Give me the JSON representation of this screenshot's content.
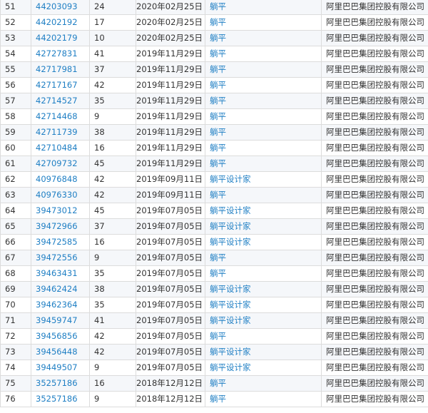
{
  "theme": {
    "link_color": "#1f7fc4",
    "text_color": "#333333",
    "border_color": "#dcdcdc",
    "stripe_color": "#f5f7fa"
  },
  "rows": [
    {
      "index": "51",
      "reg_no": "44203093",
      "class": "24",
      "date": "2020年02月25日",
      "name": "躺平",
      "owner": "阿里巴巴集团控股有限公司"
    },
    {
      "index": "52",
      "reg_no": "44202192",
      "class": "17",
      "date": "2020年02月25日",
      "name": "躺平",
      "owner": "阿里巴巴集团控股有限公司"
    },
    {
      "index": "53",
      "reg_no": "44202179",
      "class": "10",
      "date": "2020年02月25日",
      "name": "躺平",
      "owner": "阿里巴巴集团控股有限公司"
    },
    {
      "index": "54",
      "reg_no": "42727831",
      "class": "41",
      "date": "2019年11月29日",
      "name": "躺平",
      "owner": "阿里巴巴集团控股有限公司"
    },
    {
      "index": "55",
      "reg_no": "42717981",
      "class": "37",
      "date": "2019年11月29日",
      "name": "躺平",
      "owner": "阿里巴巴集团控股有限公司"
    },
    {
      "index": "56",
      "reg_no": "42717167",
      "class": "42",
      "date": "2019年11月29日",
      "name": "躺平",
      "owner": "阿里巴巴集团控股有限公司"
    },
    {
      "index": "57",
      "reg_no": "42714527",
      "class": "35",
      "date": "2019年11月29日",
      "name": "躺平",
      "owner": "阿里巴巴集团控股有限公司"
    },
    {
      "index": "58",
      "reg_no": "42714468",
      "class": "9",
      "date": "2019年11月29日",
      "name": "躺平",
      "owner": "阿里巴巴集团控股有限公司"
    },
    {
      "index": "59",
      "reg_no": "42711739",
      "class": "38",
      "date": "2019年11月29日",
      "name": "躺平",
      "owner": "阿里巴巴集团控股有限公司"
    },
    {
      "index": "60",
      "reg_no": "42710484",
      "class": "16",
      "date": "2019年11月29日",
      "name": "躺平",
      "owner": "阿里巴巴集团控股有限公司"
    },
    {
      "index": "61",
      "reg_no": "42709732",
      "class": "45",
      "date": "2019年11月29日",
      "name": "躺平",
      "owner": "阿里巴巴集团控股有限公司"
    },
    {
      "index": "62",
      "reg_no": "40976848",
      "class": "42",
      "date": "2019年09月11日",
      "name": "躺平设计家",
      "owner": "阿里巴巴集团控股有限公司"
    },
    {
      "index": "63",
      "reg_no": "40976330",
      "class": "42",
      "date": "2019年09月11日",
      "name": "躺平",
      "owner": "阿里巴巴集团控股有限公司"
    },
    {
      "index": "64",
      "reg_no": "39473012",
      "class": "45",
      "date": "2019年07月05日",
      "name": "躺平设计家",
      "owner": "阿里巴巴集团控股有限公司"
    },
    {
      "index": "65",
      "reg_no": "39472966",
      "class": "37",
      "date": "2019年07月05日",
      "name": "躺平设计家",
      "owner": "阿里巴巴集团控股有限公司"
    },
    {
      "index": "66",
      "reg_no": "39472585",
      "class": "16",
      "date": "2019年07月05日",
      "name": "躺平设计家",
      "owner": "阿里巴巴集团控股有限公司"
    },
    {
      "index": "67",
      "reg_no": "39472556",
      "class": "9",
      "date": "2019年07月05日",
      "name": "躺平",
      "owner": "阿里巴巴集团控股有限公司"
    },
    {
      "index": "68",
      "reg_no": "39463431",
      "class": "35",
      "date": "2019年07月05日",
      "name": "躺平",
      "owner": "阿里巴巴集团控股有限公司"
    },
    {
      "index": "69",
      "reg_no": "39462424",
      "class": "38",
      "date": "2019年07月05日",
      "name": "躺平设计家",
      "owner": "阿里巴巴集团控股有限公司"
    },
    {
      "index": "70",
      "reg_no": "39462364",
      "class": "35",
      "date": "2019年07月05日",
      "name": "躺平设计家",
      "owner": "阿里巴巴集团控股有限公司"
    },
    {
      "index": "71",
      "reg_no": "39459747",
      "class": "41",
      "date": "2019年07月05日",
      "name": "躺平设计家",
      "owner": "阿里巴巴集团控股有限公司"
    },
    {
      "index": "72",
      "reg_no": "39456856",
      "class": "42",
      "date": "2019年07月05日",
      "name": "躺平",
      "owner": "阿里巴巴集团控股有限公司"
    },
    {
      "index": "73",
      "reg_no": "39456448",
      "class": "42",
      "date": "2019年07月05日",
      "name": "躺平设计家",
      "owner": "阿里巴巴集团控股有限公司"
    },
    {
      "index": "74",
      "reg_no": "39449507",
      "class": "9",
      "date": "2019年07月05日",
      "name": "躺平设计家",
      "owner": "阿里巴巴集团控股有限公司"
    },
    {
      "index": "75",
      "reg_no": "35257186",
      "class": "16",
      "date": "2018年12月12日",
      "name": "躺平",
      "owner": "阿里巴巴集团控股有限公司"
    },
    {
      "index": "76",
      "reg_no": "35257186",
      "class": "9",
      "date": "2018年12月12日",
      "name": "躺平",
      "owner": "阿里巴巴集团控股有限公司"
    }
  ]
}
